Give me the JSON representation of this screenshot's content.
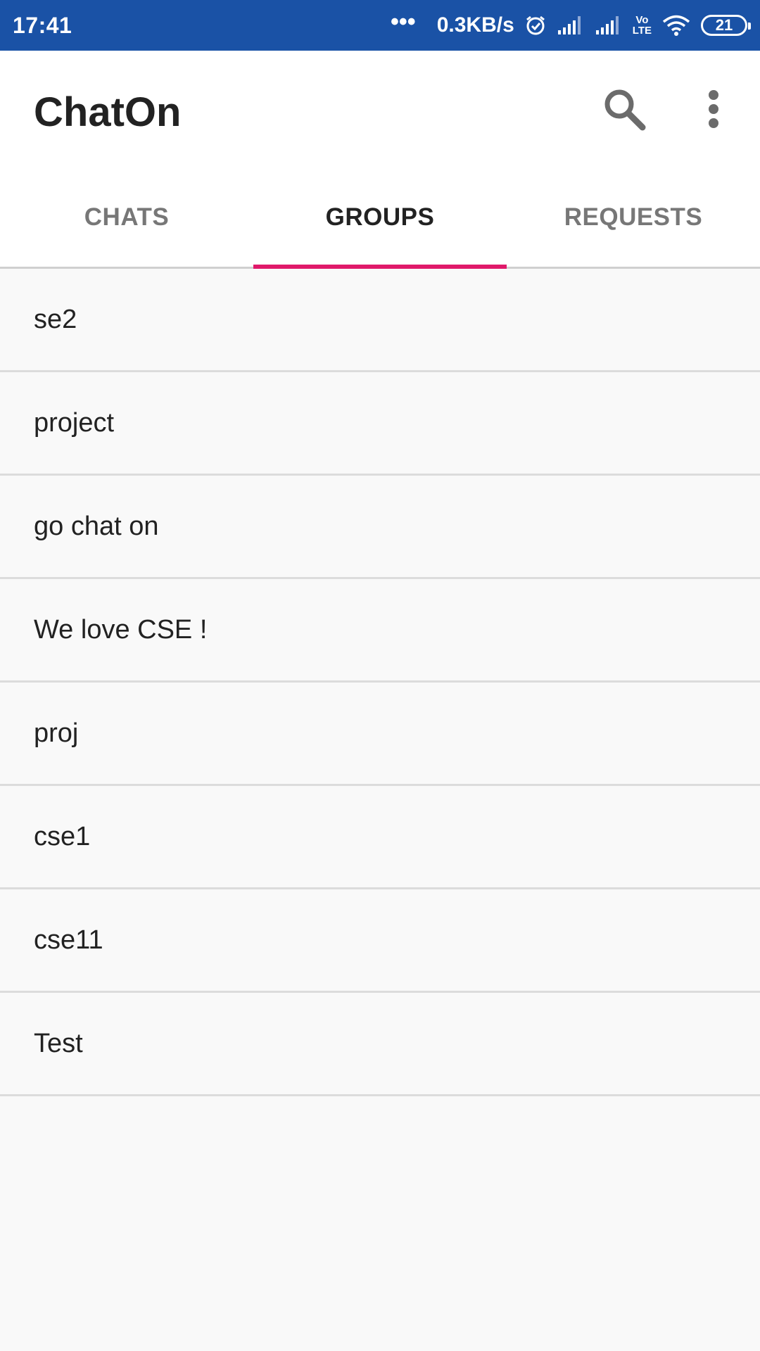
{
  "status_bar": {
    "time": "17:41",
    "dots": "•••",
    "net_speed": "0.3KB/s",
    "volte_top": "Vo",
    "volte_bottom": "LTE",
    "battery": "21"
  },
  "app_bar": {
    "title": "ChatOn"
  },
  "tabs": [
    {
      "label": "CHATS",
      "active": false
    },
    {
      "label": "GROUPS",
      "active": true
    },
    {
      "label": "REQUESTS",
      "active": false
    }
  ],
  "groups": [
    {
      "name": "se2"
    },
    {
      "name": "project"
    },
    {
      "name": "go chat on"
    },
    {
      "name": "We love CSE !"
    },
    {
      "name": "proj"
    },
    {
      "name": "cse1"
    },
    {
      "name": "cse11"
    },
    {
      "name": "Test"
    }
  ],
  "colors": {
    "status_bar": "#1a52a6",
    "tab_indicator": "#e0196a"
  }
}
